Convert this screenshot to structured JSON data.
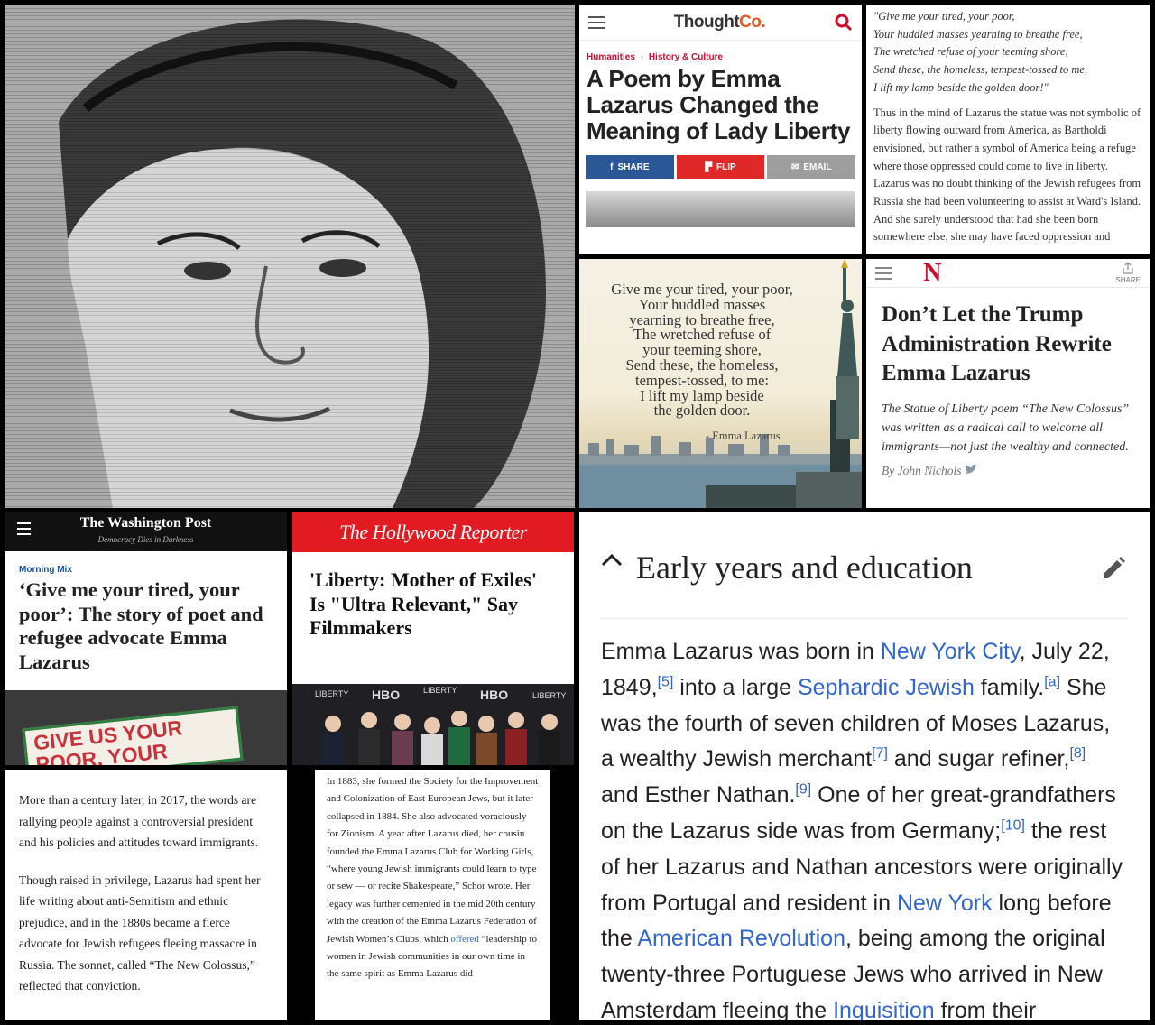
{
  "thoughtco": {
    "brand_main": "Thought",
    "brand_accent": "Co.",
    "crumb_1": "Humanities",
    "crumb_sep": "›",
    "crumb_2": "History & Culture",
    "title": "A Poem by Emma Lazarus Changed the Meaning of Lady Liberty",
    "share_label": "SHARE",
    "flip_label": "FLIP",
    "email_label": "EMAIL",
    "colors": {
      "share": "#2b5797",
      "flip": "#e12828",
      "email": "#9e9e9e"
    }
  },
  "poem_text_panel": {
    "poem_lines": [
      "\"Give me your tired, your poor,",
      "Your huddled masses yearning to breathe free,",
      "The wretched refuse of your teeming shore,",
      "Send these, the homeless, tempest-tossed to me,",
      "I lift my lamp beside the golden door!\""
    ],
    "body": "Thus in the mind of Lazarus the statue was not symbolic of liberty flowing outward from America, as Bartholdi envisioned, but rather a symbol of America being a refuge where those oppressed could come to live in liberty. Lazarus was no doubt thinking of the Jewish refugees from Russia she had been volunteering to assist at Ward's Island. And she surely understood that had she been born somewhere else, she may have faced oppression and"
  },
  "poem_image": {
    "lines": [
      "Give me your tired, your poor,",
      "Your huddled masses",
      "yearning to breathe free,",
      "The wretched refuse of",
      "your teeming shore,",
      "Send these, the homeless,",
      "tempest-tossed, to me:",
      "I lift my lamp beside",
      "the golden door."
    ],
    "author": "- Emma Lazarus"
  },
  "nation": {
    "logo": "N",
    "share_label": "SHARE",
    "title": "Don’t Let the Trump Administration Rewrite Emma Lazarus",
    "dek": "The Statue of Liberty poem “The New Colossus” was written as a radical call to welcome all immigrants—not just the wealthy and connected.",
    "byline": "By John Nichols"
  },
  "wapo": {
    "brand": "The Washington Post",
    "tagline": "Democracy Dies in Darkness",
    "kicker": "Morning Mix",
    "title": "‘Give me your tired, your poor’: The story of poet and refugee advocate Emma Lazarus",
    "sign_text": "GIVE US YOUR POOR, YOUR"
  },
  "thr": {
    "logo": "The Hollywood Reporter",
    "title": "'Liberty: Mother of Exiles' Is \"Ultra Relevant,\" Say Filmmakers",
    "backdrop_1": "LIBERTY",
    "backdrop_2": "HBO"
  },
  "text_left": {
    "p1": "More than a century later, in 2017, the words are rallying people against a controversial president and his policies and attitudes toward immigrants.",
    "p2": "Though raised in privilege, Lazarus had spent her life writing about anti-Semitism and ethnic prejudice, and in the 1880s became a fierce advocate for Jewish refugees fleeing massacre in Russia. The sonnet, called “The New Colossus,” reflected that conviction."
  },
  "text_mid": {
    "before_link": "In 1883, she formed the Society for the Improvement and Colonization of East European Jews, but it later collapsed in 1884. She also advocated voraciously for Zionism. A year after Lazarus died, her cousin founded the Emma Lazarus Club for Working Girls, “where young Jewish immigrants could learn to type or sew — or recite Shakespeare,” Schor wrote. Her legacy was further cemented in the mid 20th century with the creation of the Emma Lazarus Federation of Jewish Women’s Clubs, which ",
    "link": "offered",
    "after_link": " “leadership to women in Jewish communities in our own time in the same spirit as Emma Lazarus did"
  },
  "wiki": {
    "heading": "Early years and education",
    "t1": "Emma Lazarus was born in ",
    "l1": "New York City",
    "t2": ", July 22, 1849,",
    "r5": "[5]",
    "t3": " into a large ",
    "l2": "Sephardic Jewish",
    "t4": " family.",
    "ra": "[a]",
    "t5": " She was the fourth of seven children of Moses Lazarus, a wealthy Jewish merchant",
    "r7": "[7]",
    "t6": " and sugar refiner,",
    "r8": "[8]",
    "t7": " and Esther Nathan.",
    "r9": "[9]",
    "t8": " One of her great-grandfathers on the Lazarus side was from Germany;",
    "r10": "[10]",
    "t9": " the rest of her Lazarus and Nathan ancestors were originally from Portugal and resident in ",
    "l3": "New York",
    "t10": " long before the ",
    "l4": "American Revolution",
    "t11": ", being among the original twenty-three Portuguese Jews who arrived in New Amsterdam fleeing the ",
    "l5": "Inquisition",
    "t12": " from their",
    "link_color": "#3366cc"
  }
}
